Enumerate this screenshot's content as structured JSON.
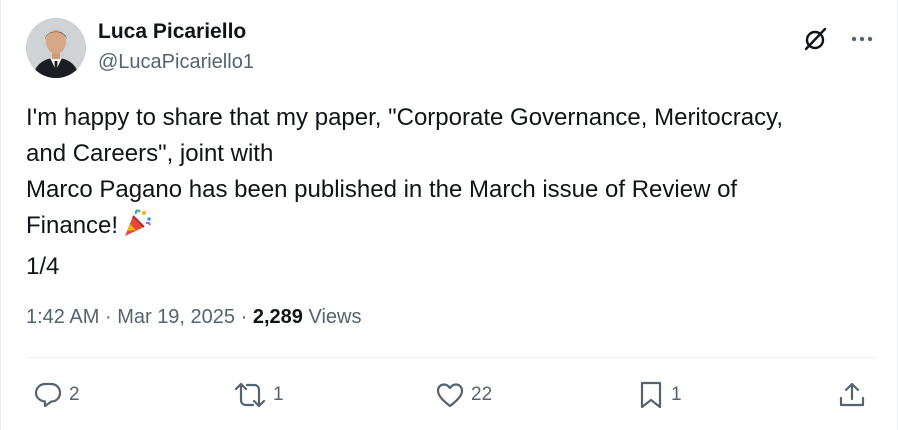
{
  "author": {
    "name": "Luca Picariello",
    "handle": "@LucaPicariello1"
  },
  "tweet": {
    "lines": [
      "I'm happy to share that my paper, \"Corporate Governance, Meritocracy,",
      "and Careers\", joint with",
      "Marco Pagano has been published in the March issue of Review of",
      "Finance!",
      "1/4"
    ],
    "emoji": "party-popper-icon"
  },
  "meta": {
    "time": "1:42 AM",
    "sep1": "·",
    "date": "Mar 19, 2025",
    "sep2": "·",
    "views_count": "2,289",
    "views_label": "Views"
  },
  "actions": {
    "replies": "2",
    "reposts": "1",
    "likes": "22",
    "bookmarks": "1"
  },
  "icons": {
    "grok": "grok-icon",
    "more": "more-horizontal-icon",
    "reply": "reply-icon",
    "repost": "repost-icon",
    "like": "heart-icon",
    "bookmark": "bookmark-icon",
    "share": "share-icon"
  },
  "colors": {
    "text": "#0f1419",
    "muted": "#536471",
    "divider": "#eff3f4"
  }
}
